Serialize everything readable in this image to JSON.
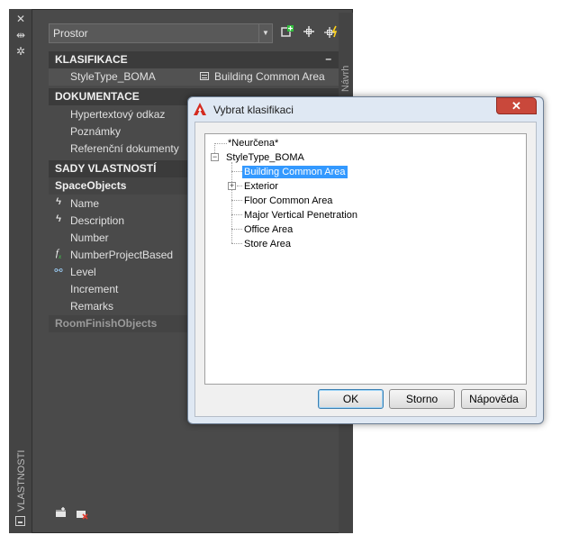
{
  "palette": {
    "side_title": "VLASTNOSTI",
    "right_tab": "Návrh",
    "object_select": "Prostor",
    "categories": {
      "klasifikace": "KLASIFIKACE",
      "dokumentace": "DOKUMENTACE",
      "sady": "SADY VLASTNOSTÍ",
      "space_objects": "SpaceObjects",
      "room_finish": "RoomFinishObjects"
    },
    "klasifikace_rows": [
      {
        "label": "StyleType_BOMA",
        "value": "Building Common Area"
      }
    ],
    "dokumentace_rows": [
      {
        "label": "Hypertextový odkaz"
      },
      {
        "label": "Poznámky"
      },
      {
        "label": "Referenční dokumenty"
      }
    ],
    "space_rows": [
      {
        "label": "Name",
        "icon": "lightning-icon"
      },
      {
        "label": "Description",
        "icon": "lightning-icon"
      },
      {
        "label": "Number"
      },
      {
        "label": "NumberProjectBased",
        "icon": "formula-icon"
      },
      {
        "label": "Level",
        "icon": "link-icon"
      },
      {
        "label": "Increment"
      },
      {
        "label": "Remarks"
      }
    ],
    "icons": {
      "close": "✕",
      "pin": "⇹",
      "settings": "✲"
    }
  },
  "dialog": {
    "title": "Vybrat klasifikaci",
    "close_label": "✕",
    "tree": {
      "undefined": "*Neurčena*",
      "root": "StyleType_BOMA",
      "children": [
        "Building Common Area",
        "Exterior",
        "Floor Common Area",
        "Major Vertical Penetration",
        "Office Area",
        "Store Area"
      ],
      "selected": "Building Common Area"
    },
    "buttons": {
      "ok": "OK",
      "cancel": "Storno",
      "help": "Nápověda"
    }
  },
  "colors": {
    "palette_bg": "#4a4a4a",
    "category_bg": "#3b3b3b",
    "dialog_frame": "#dfe8f3",
    "selection": "#3399ff",
    "close_red": "#c9483b"
  }
}
